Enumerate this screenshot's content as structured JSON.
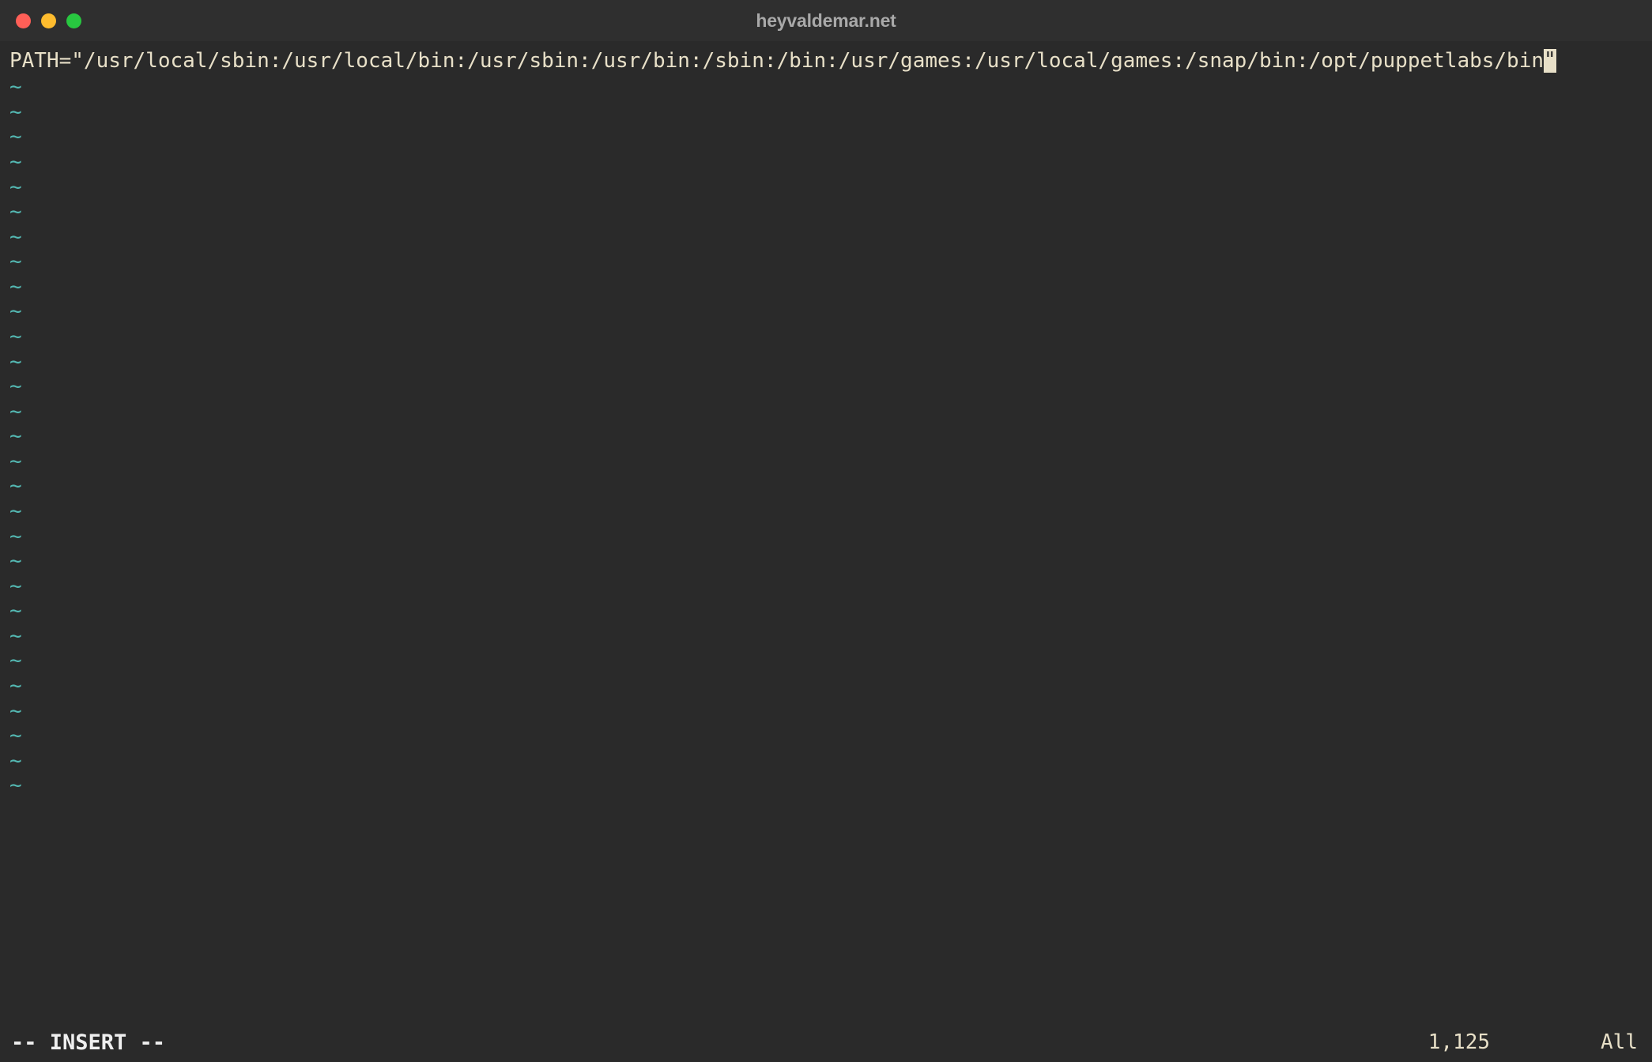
{
  "window": {
    "title": "heyvaldemar.net"
  },
  "editor": {
    "content_before_cursor": "PATH=\"/usr/local/sbin:/usr/local/bin:/usr/sbin:/usr/bin:/sbin:/bin:/usr/games:/usr/local/games:/snap/bin:/opt/puppetlabs/bin",
    "tilde": "~",
    "tilde_count": 29
  },
  "status": {
    "mode": "-- INSERT --",
    "position": "1,125",
    "scroll": "All"
  }
}
